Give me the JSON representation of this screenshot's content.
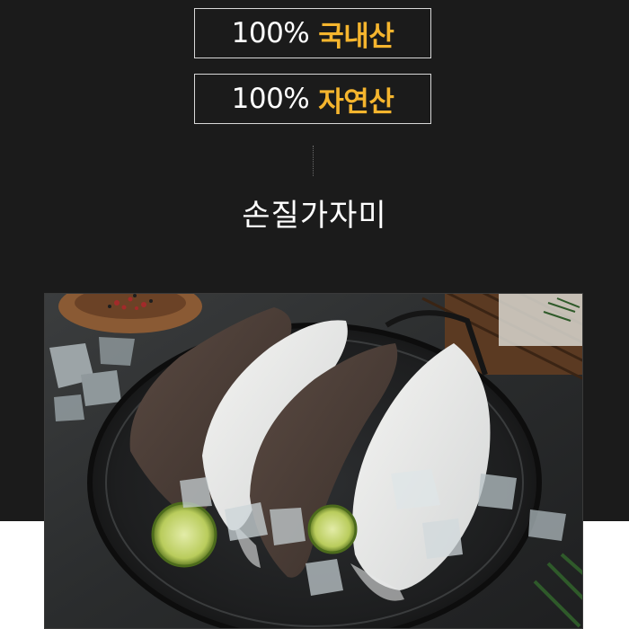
{
  "badges": [
    {
      "number": "100%",
      "highlight": "국내산"
    },
    {
      "number": "100%",
      "highlight": "자연산"
    }
  ],
  "product": {
    "name": "손질가자미"
  },
  "colors": {
    "background": "#1b1b1b",
    "accent": "#f5b52e",
    "text": "#ffffff"
  },
  "photo": {
    "subject": "fish-platter-photo"
  }
}
